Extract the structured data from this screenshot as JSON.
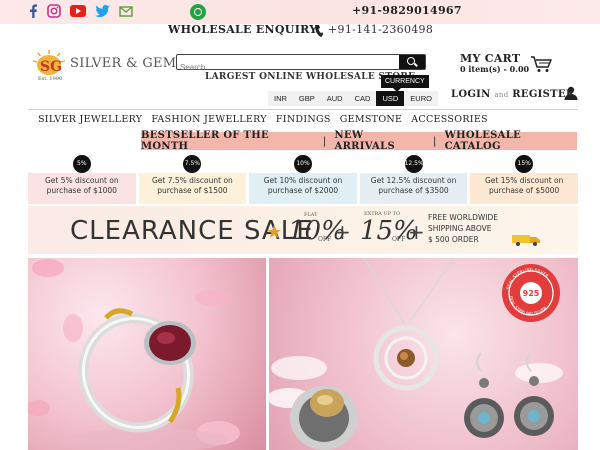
{
  "topbar": {
    "social_icons": [
      "facebook-icon",
      "instagram-icon",
      "youtube-icon",
      "twitter-icon",
      "email-icon"
    ],
    "phone": "+91-9829014967",
    "whatsapp_icon": "whatsapp-icon"
  },
  "enquiry": {
    "label": "WHOLESALE ENQUIRY",
    "phone": "+91-141-2360498"
  },
  "logo": {
    "mark": "SG",
    "text": "SILVER & GEM",
    "est": "Est. 1990"
  },
  "search": {
    "placeholder": "Search",
    "tagline": "LARGEST ONLINE WHOLESALE STORE"
  },
  "currency": {
    "tooltip": "CURRENCY",
    "options": [
      "INR",
      "GBP",
      "AUD",
      "CAD",
      "USD",
      "EURO"
    ],
    "selected": "USD"
  },
  "cart": {
    "title": "MY CART",
    "summary": "0 item(s) - 0.00"
  },
  "account": {
    "login": "LOGIN",
    "and": "and",
    "register": "REGISTER"
  },
  "nav": {
    "items": [
      "SILVER JEWELLERY",
      "FASHION JEWELLERY",
      "FINDINGS",
      "GEMSTONE",
      "ACCESSORIES"
    ]
  },
  "promo": {
    "links": [
      "BESTSELLER OF THE MONTH",
      "NEW ARRIVALS",
      "WHOLESALE CATALOG"
    ]
  },
  "discounts": [
    {
      "badge": "5%",
      "line1": "Get 5% discount on",
      "line2": "purchase of $1000",
      "color": "#fbe3e3"
    },
    {
      "badge": "7.5%",
      "line1": "Get 7.5% discount on",
      "line2": "purchase of $1500",
      "color": "#fdf1d9"
    },
    {
      "badge": "10%",
      "line1": "Get 10% discount on",
      "line2": "purchase of $2000",
      "color": "#dfeff3"
    },
    {
      "badge": "12.5%",
      "line1": "Get 12.5% discount on",
      "line2": "purchase of $3500",
      "color": "#e6eef3"
    },
    {
      "badge": "15%",
      "line1": "Get 15% discount on",
      "line2": "purchase of $5000",
      "color": "#fde9d3"
    }
  ],
  "clearance": {
    "title": "CLEARANCE SALE",
    "flat_label": "FLAT",
    "flat_value": "10%",
    "flat_off": "OFF",
    "extra_label": "EXTRA UP TO",
    "extra_value": "15%",
    "extra_off": "OFF",
    "shipping_line1": "FREE WORLDWIDE",
    "shipping_line2": "SHIPPING ABOVE",
    "shipping_line3": "$ 500 ORDER"
  },
  "hero": {
    "badge_top": "REAL STERLING SILVER",
    "badge_center": "925",
    "badge_bottom": "REAL STERLING SILVER"
  },
  "colors": {
    "promo_bar": "#f2b6aa",
    "accent_red": "#c0392b",
    "whatsapp": "#25a244"
  }
}
